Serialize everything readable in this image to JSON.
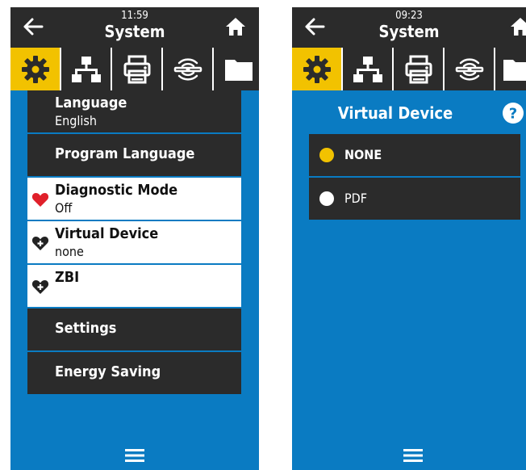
{
  "left_screen": {
    "header": {
      "time": "11:59",
      "title": "System"
    },
    "tabs": [
      "settings",
      "network",
      "print",
      "connectivity",
      "storage"
    ],
    "menu": [
      {
        "label": "Language",
        "value": "English",
        "style": "dark"
      },
      {
        "label": "Program Language",
        "value": "",
        "style": "dark"
      },
      {
        "label": "Diagnostic Mode",
        "value": "Off",
        "style": "light",
        "icon": "heart-red-icon"
      },
      {
        "label": "Virtual Device",
        "value": "none",
        "style": "light",
        "icon": "heart-plus-icon"
      },
      {
        "label": "ZBI",
        "value": "",
        "style": "light",
        "icon": "heart-plus-icon"
      },
      {
        "label": "Settings",
        "value": "",
        "style": "dark"
      },
      {
        "label": "Energy Saving",
        "value": "",
        "style": "dark"
      }
    ]
  },
  "right_screen": {
    "header": {
      "time": "09:23",
      "title": "System"
    },
    "page_title": "Virtual Device",
    "help_label": "?",
    "options": [
      {
        "label": "NONE",
        "selected": true
      },
      {
        "label": "PDF",
        "selected": false
      }
    ]
  },
  "colors": {
    "background": "#0a7bc2",
    "header": "#2b2b2b",
    "accent": "#f2c200",
    "heart_red": "#e0202a"
  }
}
